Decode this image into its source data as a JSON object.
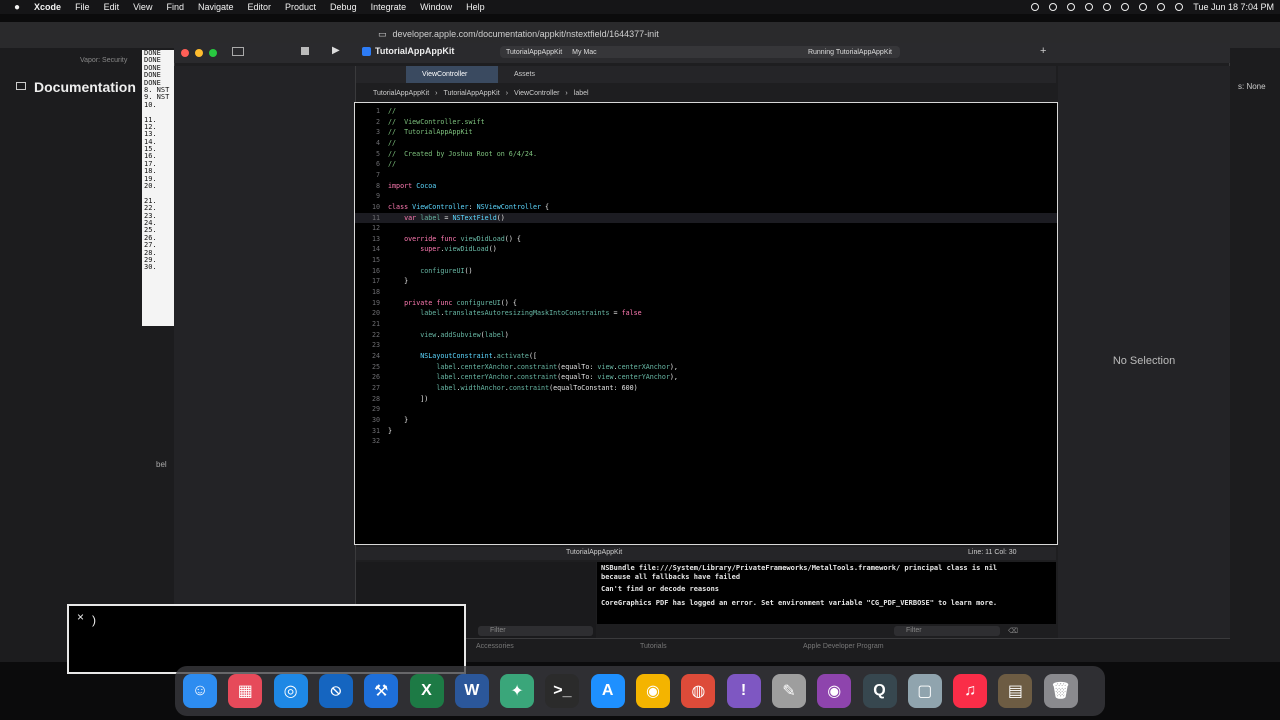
{
  "menubar": {
    "apple": "",
    "app": "Xcode",
    "items": [
      "File",
      "Edit",
      "View",
      "Find",
      "Navigate",
      "Editor",
      "Product",
      "Debug",
      "Integrate",
      "Window",
      "Help"
    ],
    "clock": "Tue Jun 18  7:04 PM"
  },
  "browser": {
    "url": "developer.apple.com/documentation/appkit/nstextfield/1644377-init",
    "tab_label": "Vapor: Security",
    "doc_title": "Documentation",
    "inspector_text": "s: None"
  },
  "terminal_lines": [
    "DONE",
    "DONE",
    "DONE",
    "DONE",
    "DONE",
    "8. NST",
    "9. NST",
    "10.",
    "",
    "11.",
    "12.",
    "13.",
    "14.",
    "15.",
    "16.",
    "17.",
    "18.",
    "19.",
    "20.",
    "",
    "21.",
    "22.",
    "23.",
    "24.",
    "25.",
    "26.",
    "27.",
    "28.",
    "29.",
    "30."
  ],
  "xcode": {
    "project": "TutorialAppAppKit",
    "scheme": "TutorialAppAppKit",
    "destination": "My Mac",
    "status": "Running TutorialAppAppKit",
    "tabs": [
      "ViewController",
      "Assets"
    ],
    "jumpbar": [
      "TutorialAppAppKit",
      "TutorialAppAppKit",
      "ViewController",
      "label"
    ],
    "no_selection": "No Selection",
    "debug_target": "TutorialAppAppKit",
    "line_col": "Line: 11  Col: 30",
    "filter_placeholder": "Filter"
  },
  "code_lines": [
    {
      "n": "1",
      "t": "//"
    },
    {
      "n": "2",
      "t": "//  ViewController.swift"
    },
    {
      "n": "3",
      "t": "//  TutorialAppAppKit"
    },
    {
      "n": "4",
      "t": "//"
    },
    {
      "n": "5",
      "t": "//  Created by Joshua Root on 6/4/24."
    },
    {
      "n": "6",
      "t": "//"
    },
    {
      "n": "7",
      "t": ""
    },
    {
      "n": "8",
      "t": "import Cocoa"
    },
    {
      "n": "9",
      "t": ""
    },
    {
      "n": "10",
      "t": "class ViewController: NSViewController {"
    },
    {
      "n": "11",
      "t": "    var label = NSTextField()"
    },
    {
      "n": "12",
      "t": ""
    },
    {
      "n": "13",
      "t": "    override func viewDidLoad() {"
    },
    {
      "n": "14",
      "t": "        super.viewDidLoad()"
    },
    {
      "n": "15",
      "t": ""
    },
    {
      "n": "16",
      "t": "        configureUI()"
    },
    {
      "n": "17",
      "t": "    }"
    },
    {
      "n": "18",
      "t": ""
    },
    {
      "n": "19",
      "t": "    private func configureUI() {"
    },
    {
      "n": "20",
      "t": "        label.translatesAutoresizingMaskIntoConstraints = false"
    },
    {
      "n": "21",
      "t": ""
    },
    {
      "n": "22",
      "t": "        view.addSubview(label)"
    },
    {
      "n": "23",
      "t": ""
    },
    {
      "n": "24",
      "t": "        NSLayoutConstraint.activate(["
    },
    {
      "n": "25",
      "t": "            label.centerXAnchor.constraint(equalTo: view.centerXAnchor),"
    },
    {
      "n": "26",
      "t": "            label.centerYAnchor.constraint(equalTo: view.centerYAnchor),"
    },
    {
      "n": "27",
      "t": "            label.widthAnchor.constraint(equalToConstant: 600)"
    },
    {
      "n": "28",
      "t": "        ])"
    },
    {
      "n": "29",
      "t": ""
    },
    {
      "n": "30",
      "t": "    }"
    },
    {
      "n": "31",
      "t": "}"
    },
    {
      "n": "32",
      "t": ""
    }
  ],
  "current_line": "11",
  "console_lines": [
    "NSBundle file:///System/Library/PrivateFrameworks/MetalTools.framework/ principal class is nil",
    "because all fallbacks have failed",
    "Can't find or decode reasons",
    "CoreGraphics PDF has logged an error. Set environment variable \"CG_PDF_VERBOSE\" to learn more."
  ],
  "popup": {
    "close": "×",
    "text": ")"
  },
  "footer_links": [
    "Accessories",
    "Tutorials",
    "Apple Developer Program"
  ],
  "dock_apps": [
    {
      "name": "finder-icon",
      "glyph": "☺",
      "color": "#2d8cf0"
    },
    {
      "name": "launchpad-icon",
      "glyph": "▦",
      "color": "#e64a5a"
    },
    {
      "name": "safari-icon",
      "glyph": "◎",
      "color": "#1e88e5"
    },
    {
      "name": "blocked-app-icon",
      "glyph": "⦸",
      "color": "#1565c0"
    },
    {
      "name": "xcode-icon",
      "glyph": "⚒",
      "color": "#1e6fd9"
    },
    {
      "name": "excel-icon",
      "glyph": "X",
      "color": "#1d7a45"
    },
    {
      "name": "word-icon",
      "glyph": "W",
      "color": "#2b579a"
    },
    {
      "name": "puzzle-app-icon",
      "glyph": "✦",
      "color": "#3aa67a"
    },
    {
      "name": "terminal-icon",
      "glyph": ">_",
      "color": "#2b2b2b"
    },
    {
      "name": "app-store-icon",
      "glyph": "A",
      "color": "#1e90ff"
    },
    {
      "name": "amphetamine-icon",
      "glyph": "◉",
      "color": "#f4b400"
    },
    {
      "name": "chrome-icon",
      "glyph": "◍",
      "color": "#dd4b39"
    },
    {
      "name": "feedback-icon",
      "glyph": "!",
      "color": "#7e57c2"
    },
    {
      "name": "textedit-icon",
      "glyph": "✎",
      "color": "#9e9e9e"
    },
    {
      "name": "podcasts-icon",
      "glyph": "◉",
      "color": "#8e44ad"
    },
    {
      "name": "quicktime-icon",
      "glyph": "Q",
      "color": "#37474f"
    },
    {
      "name": "preview-icon",
      "glyph": "▢",
      "color": "#90a4ae"
    },
    {
      "name": "music-icon",
      "glyph": "♫",
      "color": "#fa2d48"
    },
    {
      "name": "photo-stack-icon",
      "glyph": "▤",
      "color": "#6d5c43"
    },
    {
      "name": "trash-icon",
      "glyph": "🗑",
      "color": "#8a8a8e"
    }
  ]
}
